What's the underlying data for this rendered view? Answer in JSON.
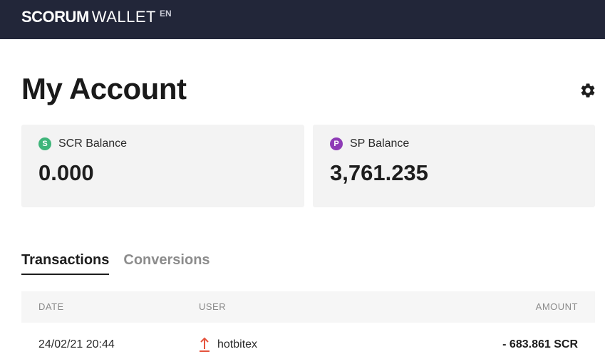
{
  "header": {
    "brand": "SCORUM",
    "product": "WALLET",
    "language": "EN"
  },
  "page": {
    "title": "My Account"
  },
  "balances": {
    "scr": {
      "label": "SCR Balance",
      "value": "0.000",
      "badge": "S",
      "color": "#3fb57a"
    },
    "sp": {
      "label": "SP Balance",
      "value": "3,761.235",
      "badge": "P",
      "color": "#8e3bb6"
    }
  },
  "tabs": [
    {
      "label": "Transactions",
      "active": true
    },
    {
      "label": "Conversions",
      "active": false
    }
  ],
  "table": {
    "headers": {
      "date": "DATE",
      "user": "USER",
      "amount": "AMOUNT"
    },
    "rows": [
      {
        "date": "24/02/21 20:44",
        "user": "hotbitex",
        "amount": "- 683.861 SCR",
        "direction_icon": "arrow-up-icon"
      }
    ]
  },
  "colors": {
    "topbar": "#222639",
    "outgoing_arrow": "#e5533d"
  }
}
